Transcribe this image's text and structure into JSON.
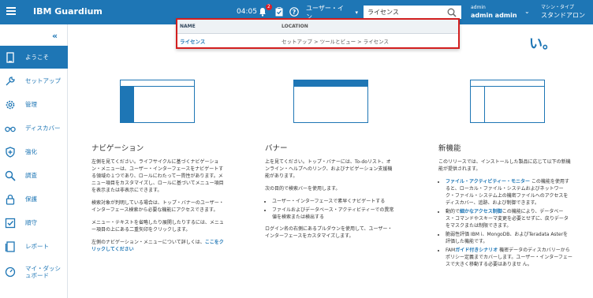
{
  "topbar": {
    "menu_icon": "hamburger-icon",
    "title": "IBM Guardium",
    "time": "04:05",
    "notification_count": "2",
    "user_select": "ユーザー・イン…",
    "search_value": "ライセンス",
    "admin_label": "admin",
    "admin_name": "admin admin",
    "mode_label": "マシン・タイプ",
    "mode_value": "スタンドアロン"
  },
  "search_results": {
    "col_name": "NAME",
    "col_location": "LOCATION",
    "rows": [
      {
        "name": "ライセンス",
        "location": "セットアップ > ツールとビュー > ライセンス"
      }
    ]
  },
  "sidebar": {
    "collapse_icon": "double-chevron-left-icon",
    "items": [
      {
        "label": "ようこそ",
        "icon": "welcome-icon"
      },
      {
        "label": "セットアップ",
        "icon": "wrench-icon"
      },
      {
        "label": "管理",
        "icon": "gear-icon"
      },
      {
        "label": "ディスカバー",
        "icon": "binoculars-icon"
      },
      {
        "label": "強化",
        "icon": "shield-icon"
      },
      {
        "label": "調査",
        "icon": "search-icon"
      },
      {
        "label": "保護",
        "icon": "lock-icon"
      },
      {
        "label": "順守",
        "icon": "checkbox-icon"
      },
      {
        "label": "レポート",
        "icon": "report-icon"
      },
      {
        "label": "マイ・ダッシュボード",
        "icon": "dashboard-icon"
      }
    ]
  },
  "main": {
    "hero_fragment": "い。",
    "nav": {
      "title": "ナビゲーション",
      "p1": "左側を見てください。ライフサイクルに基づくナビゲーション・メニューは、ユーザー・インターフェースをナビゲートする領域の１つであり、ロールにわたって一貫性があります。メニュー項目をカスタマイズし、ロールに基づいてメニュー項目を表示または非表示にできます。",
      "p2": "検索対象が判明している場合は、トップ・バナーのユーザー・インターフェース検索から必要な機能にアクセスできます。",
      "p3": "メニュー・テキストを省略したり展開したりするには、メニュー項目の上にある二重矢印をクリックします。",
      "p4_text": "左側のナビゲーション・メニューについて詳しくは、",
      "p4_link": "ここをクリックしてください"
    },
    "banner": {
      "title": "バナー",
      "p1": "上を見てください。トップ・バナーには、To-doリスト、オンライン・ヘルプへのリンク、およびナビゲーション支援機能があります。",
      "p2": "次の目的で検索バーを使用します。",
      "li1": "ユーザー・インターフェースで素早くナビゲートする",
      "li2": "ファイルおよびデータベース・アクティビティーでの異常値を検索または検出する",
      "p3": "ログイン名の右側にあるプルダウンを使用して、ユーザー・インターフェースをカスタマイズします。"
    },
    "new": {
      "title": "新機能",
      "p1": "このリリースでは、インストールした製品に応じて以下の新機能が提供されます。",
      "li1_link": "ファイル・アクティビティー・モニター",
      "li1_text": "この機能を使用すると、ローカル・ファイル・システムおよびネットワーク・ファイル・システム上の機密ファイルへのアクセスをディスカバー、追跡、および制御できます。",
      "li2_pre": "動的で",
      "li2_link": "細かなアクセス制御",
      "li2_text": "この機能により、データベース・コマンドやスキーマ変更を必要とせずに、戻りデータをマスクまたは制限できます。",
      "li3": "脆弱性評価 IBM i、MongoDB、およびTeradata Asterを評価した機能です。",
      "li4_pre": "FAM",
      "li4_link": "ガイド付きシナリオ",
      "li4_text": "機密データのディスカバリーからポリシー定義までカバーします。ユーザー・インターフェースで大きく移動する必要はありませ ん。"
    }
  }
}
